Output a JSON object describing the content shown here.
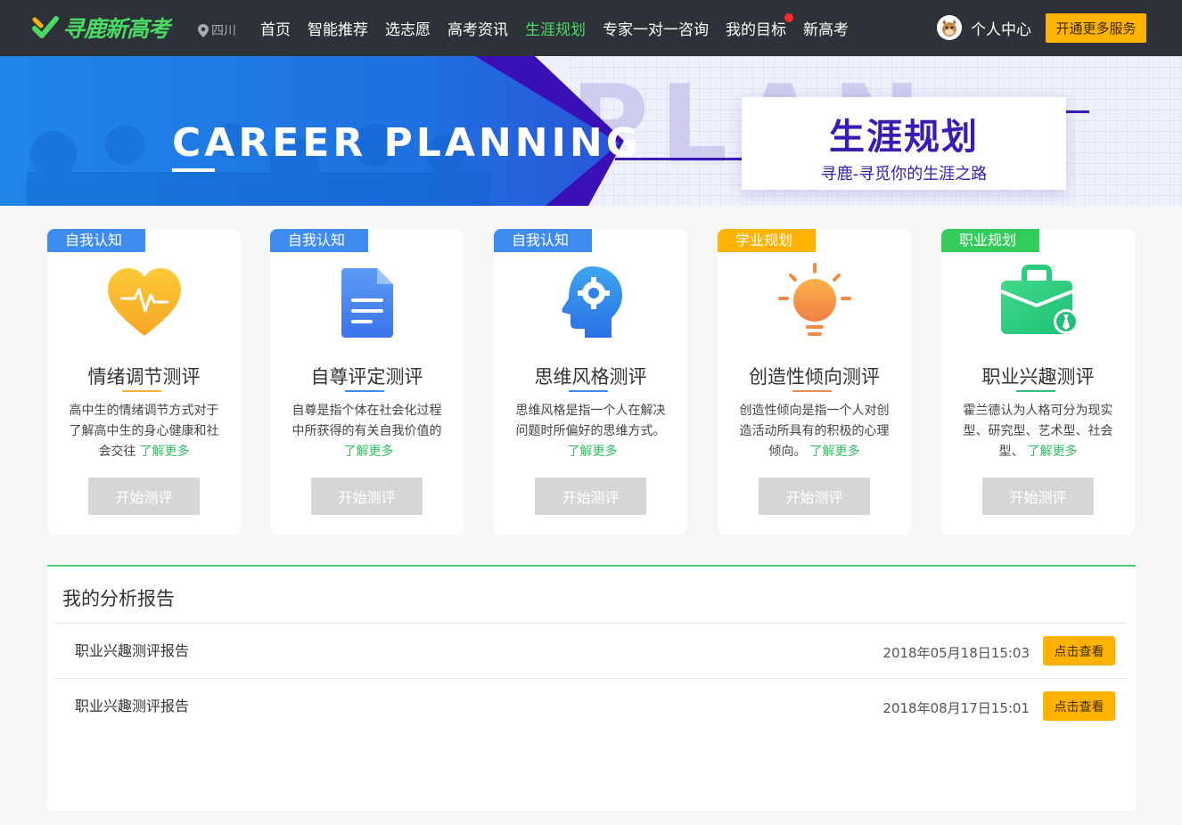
{
  "header": {
    "logo_text": "寻鹿新高考",
    "location": "四川",
    "nav": [
      {
        "label": "首页",
        "active": false
      },
      {
        "label": "智能推荐",
        "active": false
      },
      {
        "label": "选志愿",
        "active": false
      },
      {
        "label": "高考资讯",
        "active": false
      },
      {
        "label": "生涯规划",
        "active": true
      },
      {
        "label": "专家一对一咨询",
        "active": false
      },
      {
        "label": "我的目标",
        "active": false,
        "badge": true
      },
      {
        "label": "新高考",
        "active": false
      }
    ],
    "user_label": "个人中心",
    "vip_button": "开通更多服务"
  },
  "banner": {
    "english_title": "CAREER PLANNING",
    "background_word": "PLAN",
    "title": "生涯规划",
    "subtitle": "寻鹿-寻觅你的生涯之路"
  },
  "cards": [
    {
      "tag": "自我认知",
      "tag_color": "#3f8cf0",
      "icon": "heart-pulse-icon",
      "title": "情绪调节测评",
      "underline_color": "#f5b430",
      "desc": "高中生的情绪调节方式对于了解高中生的身心健康和社会交往",
      "more": "了解更多",
      "button": "开始测评"
    },
    {
      "tag": "自我认知",
      "tag_color": "#3f8cf0",
      "icon": "document-icon",
      "title": "自尊评定测评",
      "underline_color": "#3f8cf0",
      "desc": "自尊是指个体在社会化过程中所获得的有关自我价值的",
      "more": "了解更多",
      "button": "开始测评"
    },
    {
      "tag": "自我认知",
      "tag_color": "#3f8cf0",
      "icon": "head-gear-icon",
      "title": "思维风格测评",
      "underline_color": "#3f8cf0",
      "desc": "思维风格是指一个人在解决问题时所偏好的思维方式。",
      "more": "了解更多",
      "button": "开始测评"
    },
    {
      "tag": "学业规划",
      "tag_color": "#ffb300",
      "icon": "lightbulb-icon",
      "title": "创造性倾向测评",
      "underline_color": "#f08a4b",
      "desc": "创造性倾向是指一个人对创造活动所具有的积极的心理倾向。",
      "more": "了解更多",
      "button": "开始测评"
    },
    {
      "tag": "职业规划",
      "tag_color": "#33cc5a",
      "icon": "briefcase-icon",
      "title": "职业兴趣测评",
      "underline_color": "#2fbf7d",
      "desc": "霍兰德认为人格可分为现实型、研究型、艺术型、社会型、",
      "more": "了解更多",
      "button": "开始测评"
    }
  ],
  "reports": {
    "title": "我的分析报告",
    "items": [
      {
        "name": "职业兴趣测评报告",
        "date": "2018年05月18日15:03",
        "button": "点击查看"
      },
      {
        "name": "职业兴趣测评报告",
        "date": "2018年08月17日15:01",
        "button": "点击查看"
      }
    ]
  }
}
